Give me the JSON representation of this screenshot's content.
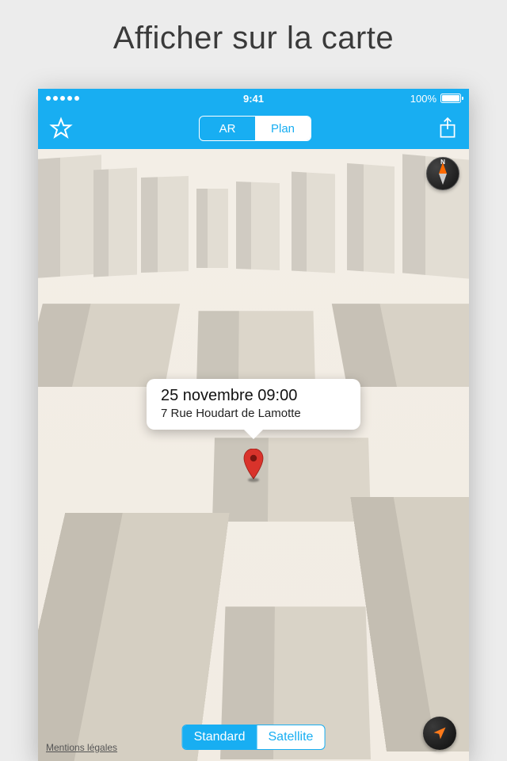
{
  "page": {
    "title": "Afficher sur la carte"
  },
  "status": {
    "time": "9:41",
    "battery_pct": "100%"
  },
  "nav": {
    "view_mode": {
      "options": [
        "AR",
        "Plan"
      ],
      "active_index": 1
    }
  },
  "callout": {
    "title": "25 novembre 09:00",
    "subtitle": "7 Rue Houdart de Lamotte"
  },
  "compass": {
    "north_label": "N"
  },
  "map_type": {
    "options": [
      "Standard",
      "Satellite"
    ],
    "active_index": 0
  },
  "legal": {
    "label": "Mentions légales"
  },
  "colors": {
    "accent": "#18aef2"
  }
}
